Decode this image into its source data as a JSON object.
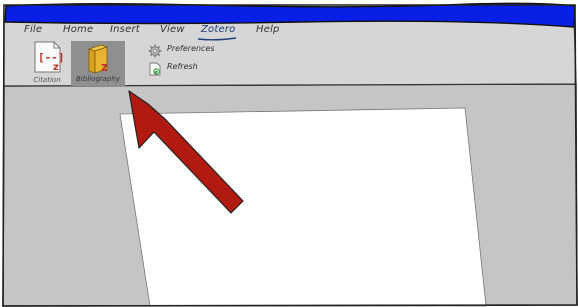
{
  "menu": {
    "items": [
      "File",
      "Home",
      "Insert",
      "View",
      "Zotero",
      "Help"
    ],
    "active_index": 4
  },
  "ribbon": {
    "citation_label": "Citation",
    "citation_icon_text": "[--]",
    "bibliography_label": "Bibliography",
    "zotero_badge": "z",
    "preferences_label": "Preferences",
    "refresh_label": "Refresh"
  },
  "colors": {
    "title_bar": "#0a1fe6",
    "accent_arrow": "#b01a10",
    "zotero_red": "#b5352a",
    "background": "#c5c5c5",
    "document": "#ffffff"
  },
  "icons": {
    "citation": "citation-icon",
    "bibliography": "bibliography-icon",
    "preferences": "gear-icon",
    "refresh": "refresh-icon",
    "callout": "arrow-icon"
  }
}
